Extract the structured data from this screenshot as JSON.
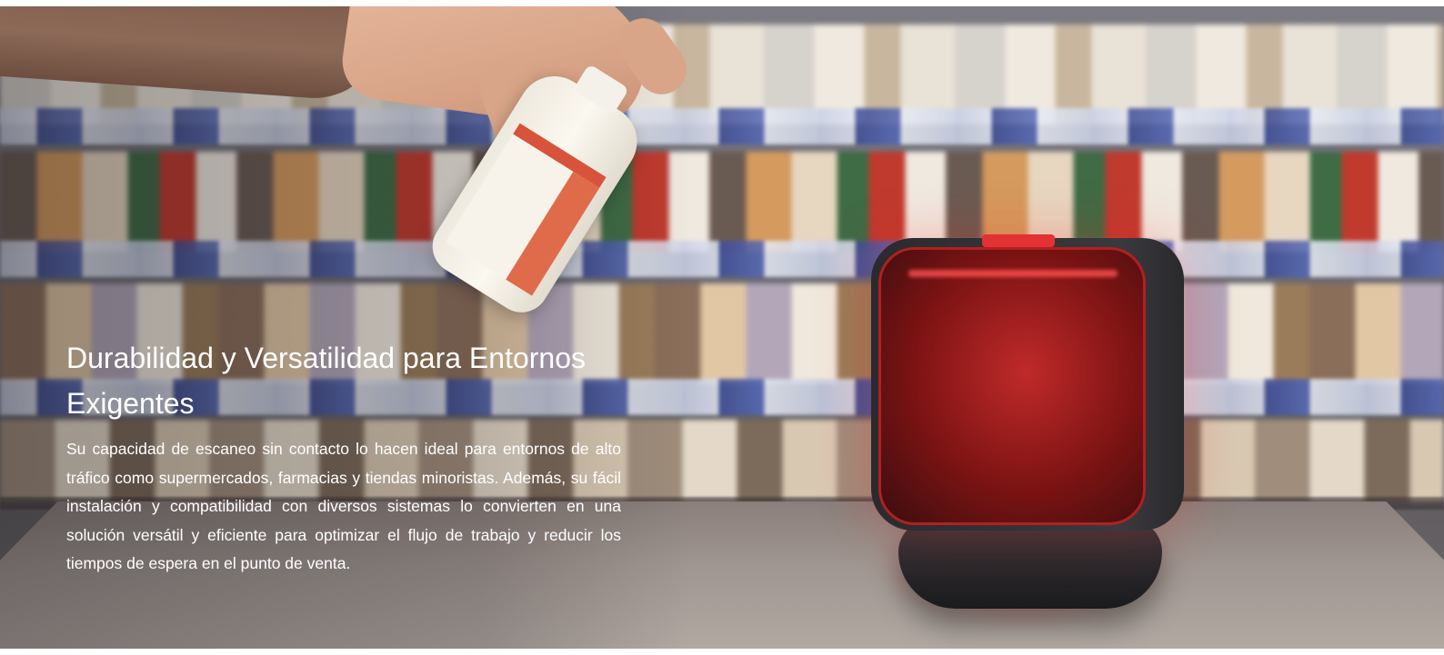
{
  "hero": {
    "headline": "Durabilidad y Versatilidad para Entornos Exigentes",
    "body": "Su capacidad de escaneo sin contacto lo hacen ideal para entornos de alto tráfico como supermercados, farmacias y tiendas minoristas. Además, su fácil instalación y compatibilidad con diversos sistemas lo convierten en una solución versátil y eficiente para optimizar el flujo de trabajo y reducir los tiempos de espera en el punto de venta."
  },
  "colors": {
    "text": "#ffffff",
    "scanner_red": "#c02a2a",
    "scanner_body": "#2b2a2e"
  }
}
